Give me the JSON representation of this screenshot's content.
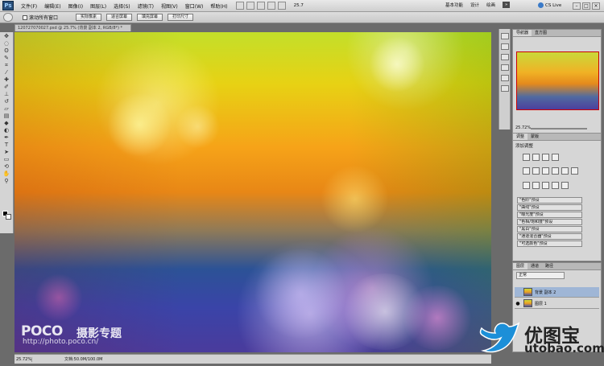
{
  "menubar": {
    "logo": "Ps",
    "items": [
      "文件(F)",
      "编辑(E)",
      "图像(I)",
      "图层(L)",
      "选择(S)",
      "滤镜(T)",
      "视图(V)",
      "窗口(W)",
      "帮助(H)"
    ],
    "zoom": "25.7",
    "workspace": [
      "基本功能",
      "设计",
      "绘画"
    ],
    "more": "»",
    "cs_live": "CS Live"
  },
  "options": {
    "checkbox_label": "滚动所有窗口",
    "buttons": [
      "实际像素",
      "适合屏幕",
      "填充屏幕",
      "打印尺寸"
    ]
  },
  "document": {
    "tab": "120727070027.psd @ 25.7% (背景 副本 2, RGB/8*) *"
  },
  "canvas_watermark": {
    "brand": "POCO",
    "subtitle": "摄影专题",
    "url": "http://photo.poco.cn/"
  },
  "status": {
    "zoom": "25.72%",
    "doc": "文档:50.0M/100.0M"
  },
  "navigator": {
    "tabs": [
      "导航器",
      "直方图"
    ],
    "zoom": "25.72%"
  },
  "adjustments": {
    "tabs": [
      "调整",
      "蒙版"
    ],
    "title": "添加调整",
    "presets": [
      "\"色阶\"预设",
      "\"曲线\"预设",
      "\"曝光度\"预设",
      "\"色相/饱和度\"预设",
      "\"黑白\"预设",
      "\"通道混合器\"预设",
      "\"可选颜色\"预设"
    ]
  },
  "layers": {
    "tabs": [
      "图层",
      "通道",
      "路径"
    ],
    "blend_mode": "正常",
    "items": [
      "背景 副本 2",
      "图层 1"
    ]
  },
  "corner_watermark": {
    "cn": "优图宝",
    "en": "utobao.com"
  },
  "colors": {
    "accent": "#1c8fd8",
    "panel": "#d6d6d6",
    "menubar": "#e0e0e0"
  }
}
